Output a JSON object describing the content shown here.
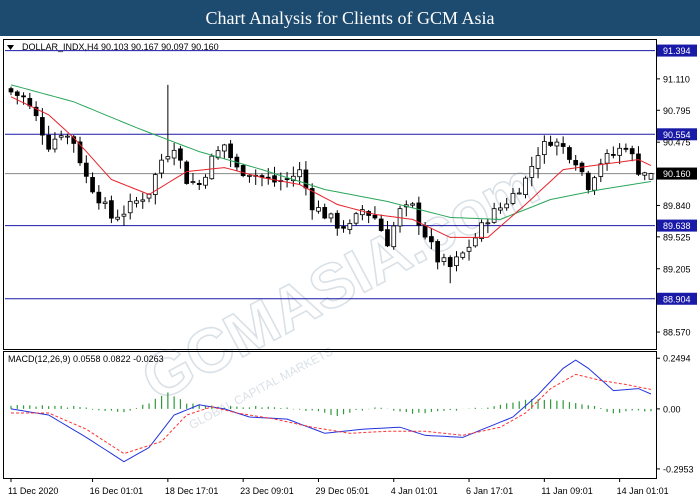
{
  "header": {
    "title": "Chart Analysis for Clients of GCM Asia"
  },
  "watermark": {
    "text": "GCMASIA.com",
    "subtext": "GLOBAL CAPITAL MARKETS"
  },
  "colors": {
    "banner": "#1d4a6f",
    "level_line": "#1a1aa8",
    "price_line": "#888888",
    "bull_candle": "#ffffff",
    "bear_candle": "#000000",
    "ma_fast": "#e8222a",
    "ma_slow": "#2aa65a",
    "macd_line": "#2233dd",
    "signal_line": "#ff3333",
    "histogram": "#2e9a3a"
  },
  "chart_data": [
    {
      "type": "candlestick",
      "title": "DOLLAR_INDX,H4  90.103 90.167 90.097 90.160",
      "symbol": "DOLLAR_INDX",
      "timeframe": "H4",
      "ohlc_last": {
        "open": 90.103,
        "high": 90.167,
        "low": 90.097,
        "close": 90.16
      },
      "ylim": [
        88.4,
        91.5
      ],
      "y_ticks": [
        "91.110",
        "90.795",
        "90.475",
        "89.840",
        "89.525",
        "89.205",
        "88.570"
      ],
      "levels": [
        {
          "label": "91.394",
          "value": 91.394
        },
        {
          "label": "90.554",
          "value": 90.554
        },
        {
          "label": "89.638",
          "value": 89.638
        },
        {
          "label": "88.904",
          "value": 88.904
        }
      ],
      "current_price": {
        "label": "90.160",
        "value": 90.16
      },
      "x_ticks": [
        "11 Dec 2020",
        "16 Dec 01:01",
        "18 Dec 17:01",
        "23 Dec 09:01",
        "29 Dec 05:01",
        "4 Jan 01:01",
        "6 Jan 17:01",
        "11 Jan 09:01",
        "14 Jan 01:01"
      ],
      "x_tick_index": [
        0,
        13,
        25,
        37,
        49,
        61,
        73,
        85,
        97
      ],
      "close_path_anchors": [
        [
          0,
          90.98
        ],
        [
          2,
          90.92
        ],
        [
          4,
          90.72
        ],
        [
          6,
          90.45
        ],
        [
          8,
          90.58
        ],
        [
          10,
          90.48
        ],
        [
          12,
          90.12
        ],
        [
          14,
          89.92
        ],
        [
          16,
          89.72
        ],
        [
          18,
          89.78
        ],
        [
          20,
          89.88
        ],
        [
          22,
          89.98
        ],
        [
          24,
          90.3
        ],
        [
          26,
          90.45
        ],
        [
          28,
          90.1
        ],
        [
          30,
          90.05
        ],
        [
          32,
          90.3
        ],
        [
          34,
          90.45
        ],
        [
          36,
          90.2
        ],
        [
          38,
          90.18
        ],
        [
          40,
          90.12
        ],
        [
          42,
          90.08
        ],
        [
          44,
          90.1
        ],
        [
          46,
          90.18
        ],
        [
          48,
          89.85
        ],
        [
          50,
          89.75
        ],
        [
          52,
          89.65
        ],
        [
          54,
          89.62
        ],
        [
          56,
          89.8
        ],
        [
          58,
          89.72
        ],
        [
          60,
          89.48
        ],
        [
          62,
          89.78
        ],
        [
          64,
          89.82
        ],
        [
          66,
          89.55
        ],
        [
          68,
          89.3
        ],
        [
          70,
          89.22
        ],
        [
          72,
          89.35
        ],
        [
          74,
          89.52
        ],
        [
          76,
          89.72
        ],
        [
          78,
          89.82
        ],
        [
          80,
          89.95
        ],
        [
          82,
          90.1
        ],
        [
          84,
          90.38
        ],
        [
          86,
          90.5
        ],
        [
          88,
          90.42
        ],
        [
          90,
          90.3
        ],
        [
          92,
          90.05
        ],
        [
          94,
          90.28
        ],
        [
          96,
          90.35
        ],
        [
          98,
          90.45
        ],
        [
          100,
          90.2
        ],
        [
          102,
          90.16
        ]
      ],
      "candle_count": 103,
      "ma_fast_anchors": [
        [
          0,
          90.93
        ],
        [
          6,
          90.75
        ],
        [
          10,
          90.52
        ],
        [
          16,
          90.1
        ],
        [
          22,
          89.95
        ],
        [
          28,
          90.18
        ],
        [
          34,
          90.22
        ],
        [
          40,
          90.12
        ],
        [
          46,
          90.05
        ],
        [
          52,
          89.85
        ],
        [
          58,
          89.75
        ],
        [
          64,
          89.7
        ],
        [
          70,
          89.52
        ],
        [
          76,
          89.52
        ],
        [
          82,
          89.85
        ],
        [
          88,
          90.2
        ],
        [
          94,
          90.25
        ],
        [
          100,
          90.3
        ],
        [
          102,
          90.24
        ]
      ],
      "ma_slow_anchors": [
        [
          0,
          91.05
        ],
        [
          10,
          90.88
        ],
        [
          20,
          90.62
        ],
        [
          30,
          90.38
        ],
        [
          40,
          90.2
        ],
        [
          50,
          90.0
        ],
        [
          60,
          89.88
        ],
        [
          70,
          89.72
        ],
        [
          78,
          89.7
        ],
        [
          86,
          89.9
        ],
        [
          94,
          90.0
        ],
        [
          102,
          90.08
        ]
      ]
    },
    {
      "type": "line",
      "title": "MACD(12,26,9) 0.0558 0.0822 -0.0263",
      "ylim": [
        -0.34,
        0.28
      ],
      "y_ticks": [
        "0.2494",
        "0.00",
        "-0.2953"
      ],
      "macd_anchors": [
        [
          0,
          0.0
        ],
        [
          6,
          -0.03
        ],
        [
          12,
          -0.14
        ],
        [
          18,
          -0.26
        ],
        [
          22,
          -0.19
        ],
        [
          26,
          -0.03
        ],
        [
          30,
          0.02
        ],
        [
          34,
          0.0
        ],
        [
          38,
          -0.04
        ],
        [
          44,
          -0.05
        ],
        [
          50,
          -0.12
        ],
        [
          56,
          -0.1
        ],
        [
          62,
          -0.09
        ],
        [
          66,
          -0.13
        ],
        [
          72,
          -0.14
        ],
        [
          76,
          -0.09
        ],
        [
          80,
          -0.04
        ],
        [
          84,
          0.07
        ],
        [
          88,
          0.2
        ],
        [
          90,
          0.24
        ],
        [
          92,
          0.2
        ],
        [
          96,
          0.09
        ],
        [
          100,
          0.1
        ],
        [
          103,
          0.06
        ]
      ],
      "signal_anchors": [
        [
          0,
          -0.02
        ],
        [
          6,
          -0.02
        ],
        [
          12,
          -0.1
        ],
        [
          18,
          -0.22
        ],
        [
          24,
          -0.16
        ],
        [
          28,
          -0.03
        ],
        [
          32,
          0.01
        ],
        [
          36,
          -0.02
        ],
        [
          42,
          -0.05
        ],
        [
          48,
          -0.09
        ],
        [
          54,
          -0.12
        ],
        [
          60,
          -0.11
        ],
        [
          66,
          -0.11
        ],
        [
          72,
          -0.13
        ],
        [
          78,
          -0.09
        ],
        [
          82,
          -0.02
        ],
        [
          86,
          0.1
        ],
        [
          90,
          0.17
        ],
        [
          94,
          0.14
        ],
        [
          98,
          0.12
        ],
        [
          103,
          0.09
        ]
      ],
      "histogram_anchors": [
        [
          0,
          0.02
        ],
        [
          10,
          0.01
        ],
        [
          18,
          -0.02
        ],
        [
          22,
          0.03
        ],
        [
          25,
          0.08
        ],
        [
          28,
          0.03
        ],
        [
          34,
          0.01
        ],
        [
          40,
          0.01
        ],
        [
          46,
          0.0
        ],
        [
          52,
          -0.03
        ],
        [
          58,
          0.01
        ],
        [
          64,
          -0.02
        ],
        [
          70,
          -0.01
        ],
        [
          76,
          0.01
        ],
        [
          80,
          0.03
        ],
        [
          84,
          0.05
        ],
        [
          88,
          0.04
        ],
        [
          92,
          0.02
        ],
        [
          96,
          -0.02
        ],
        [
          100,
          -0.01
        ],
        [
          103,
          -0.01
        ]
      ]
    }
  ]
}
